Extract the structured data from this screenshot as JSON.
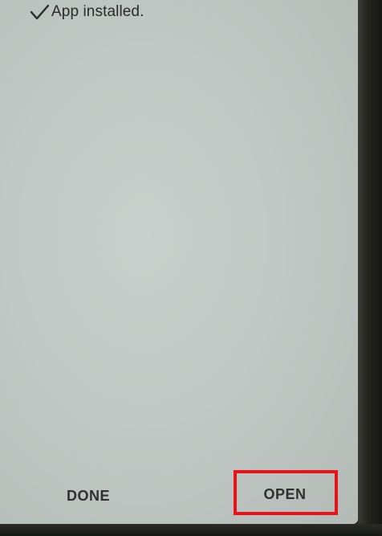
{
  "status": {
    "icon": "checkmark-icon",
    "text": "App installed."
  },
  "actions": {
    "done_label": "DONE",
    "open_label": "OPEN"
  },
  "annotation": {
    "highlight_color": "#e8121b",
    "highlighted_target": "open-button"
  }
}
